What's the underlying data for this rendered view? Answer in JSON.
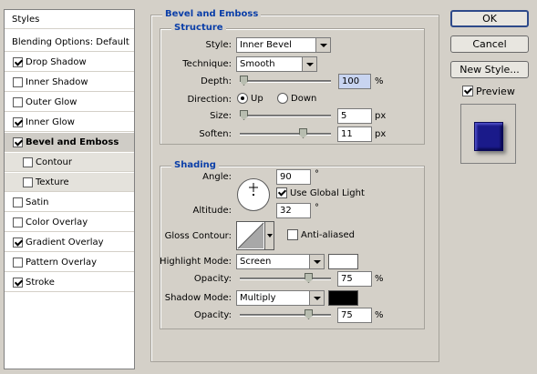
{
  "left_panel": {
    "header": "Styles",
    "items": [
      {
        "label": "Blending Options: Default",
        "checkbox": false,
        "checked": false,
        "sub": false,
        "selected": false
      },
      {
        "label": "Drop Shadow",
        "checkbox": true,
        "checked": true,
        "sub": false,
        "selected": false
      },
      {
        "label": "Inner Shadow",
        "checkbox": true,
        "checked": false,
        "sub": false,
        "selected": false
      },
      {
        "label": "Outer Glow",
        "checkbox": true,
        "checked": false,
        "sub": false,
        "selected": false
      },
      {
        "label": "Inner Glow",
        "checkbox": true,
        "checked": true,
        "sub": false,
        "selected": false
      },
      {
        "label": "Bevel and Emboss",
        "checkbox": true,
        "checked": true,
        "sub": false,
        "selected": true
      },
      {
        "label": "Contour",
        "checkbox": true,
        "checked": false,
        "sub": true,
        "selected": false
      },
      {
        "label": "Texture",
        "checkbox": true,
        "checked": false,
        "sub": true,
        "selected": false
      },
      {
        "label": "Satin",
        "checkbox": true,
        "checked": false,
        "sub": false,
        "selected": false
      },
      {
        "label": "Color Overlay",
        "checkbox": true,
        "checked": false,
        "sub": false,
        "selected": false
      },
      {
        "label": "Gradient Overlay",
        "checkbox": true,
        "checked": true,
        "sub": false,
        "selected": false
      },
      {
        "label": "Pattern Overlay",
        "checkbox": true,
        "checked": false,
        "sub": false,
        "selected": false
      },
      {
        "label": "Stroke",
        "checkbox": true,
        "checked": true,
        "sub": false,
        "selected": false
      }
    ]
  },
  "main": {
    "title": "Bevel and Emboss",
    "structure": {
      "title": "Structure",
      "style_label": "Style:",
      "style_value": "Inner Bevel",
      "technique_label": "Technique:",
      "technique_value": "Smooth",
      "depth_label": "Depth:",
      "depth_value": "100",
      "depth_unit": "%",
      "direction_label": "Direction:",
      "direction_up": "Up",
      "direction_down": "Down",
      "size_label": "Size:",
      "size_value": "5",
      "size_unit": "px",
      "soften_label": "Soften:",
      "soften_value": "11",
      "soften_unit": "px"
    },
    "shading": {
      "title": "Shading",
      "angle_label": "Angle:",
      "angle_value": "90",
      "angle_unit": "°",
      "global_light_label": "Use Global Light",
      "altitude_label": "Altitude:",
      "altitude_value": "32",
      "altitude_unit": "°",
      "gloss_contour_label": "Gloss Contour:",
      "anti_aliased_label": "Anti-aliased",
      "highlight_mode_label": "Highlight Mode:",
      "highlight_mode_value": "Screen",
      "highlight_opacity_label": "Opacity:",
      "highlight_opacity_value": "75",
      "highlight_opacity_unit": "%",
      "shadow_mode_label": "Shadow Mode:",
      "shadow_mode_value": "Multiply",
      "shadow_opacity_label": "Opacity:",
      "shadow_opacity_value": "75",
      "shadow_opacity_unit": "%"
    }
  },
  "buttons": {
    "ok": "OK",
    "cancel": "Cancel",
    "new_style": "New Style...",
    "preview_label": "Preview"
  },
  "colors": {
    "highlight_swatch": "#ffffff",
    "shadow_swatch": "#000000",
    "title_blue": "#0a3ea8",
    "preview_fill": "#1a1a8a"
  }
}
